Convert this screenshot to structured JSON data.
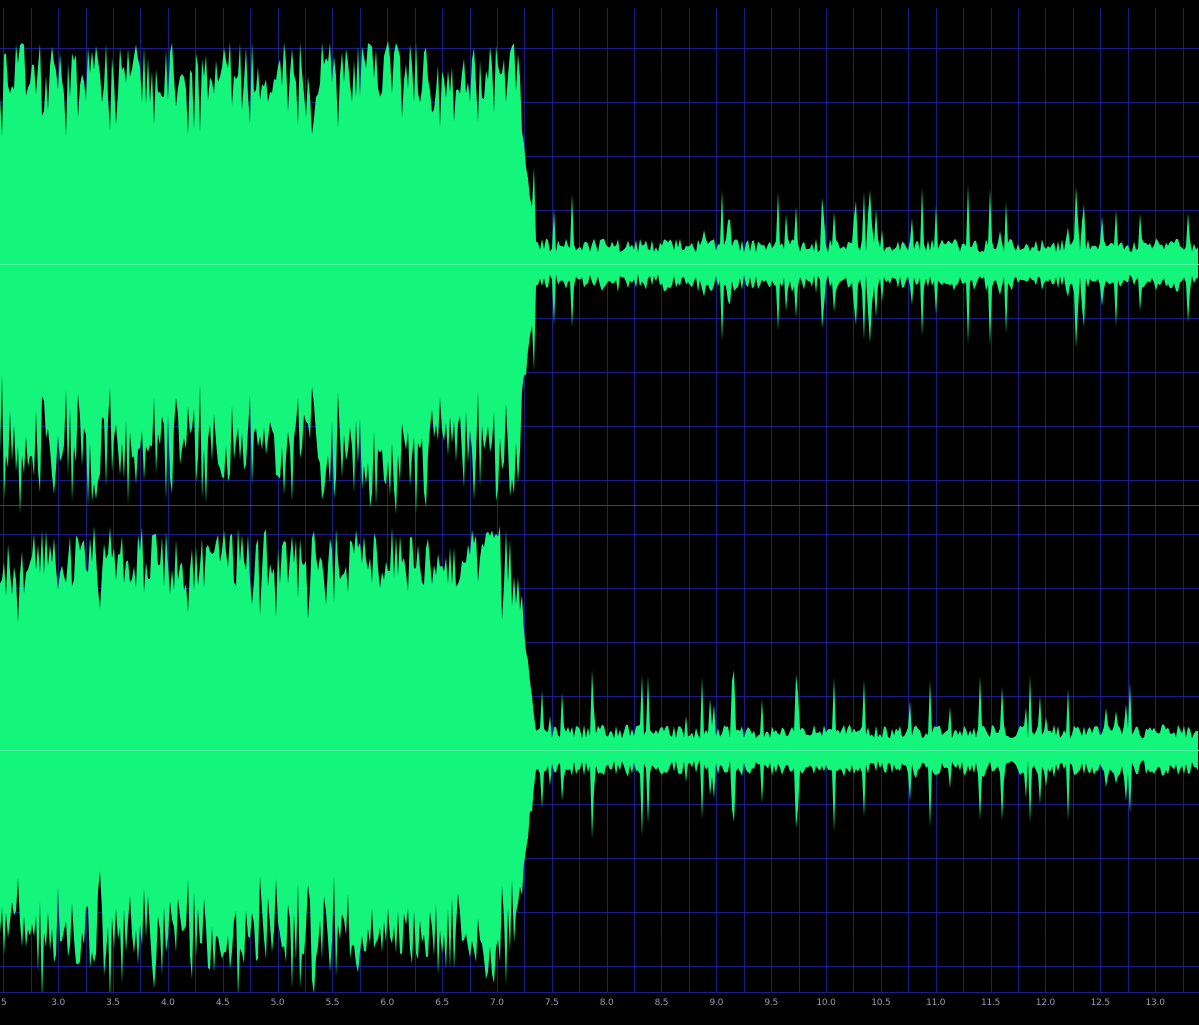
{
  "editor": {
    "view": "stereo-waveform",
    "channels": [
      "left",
      "right"
    ],
    "colors": {
      "background": "#000000",
      "waveform": "#14f57c",
      "grid": "#1c1c8a",
      "center_line": "#7cf0b0",
      "ruler_text": "#9a9ab8"
    }
  },
  "time_ruler": {
    "unit": "seconds",
    "visible_range": [
      2.47,
      13.4
    ],
    "first_partial_label": "5",
    "labels": [
      "3.0",
      "3.5",
      "4.0",
      "4.5",
      "5.0",
      "5.5",
      "6.0",
      "6.5",
      "7.0",
      "7.5",
      "8.0",
      "8.5",
      "9.0",
      "9.5",
      "10.0",
      "10.5",
      "11.0",
      "11.5",
      "12.0",
      "12.5",
      "13.0"
    ]
  },
  "waveform_levels": {
    "loud_section_end_seconds": 7.2,
    "loud_section_peak_fraction": 0.95,
    "quiet_section_peak_fraction": 0.4
  }
}
